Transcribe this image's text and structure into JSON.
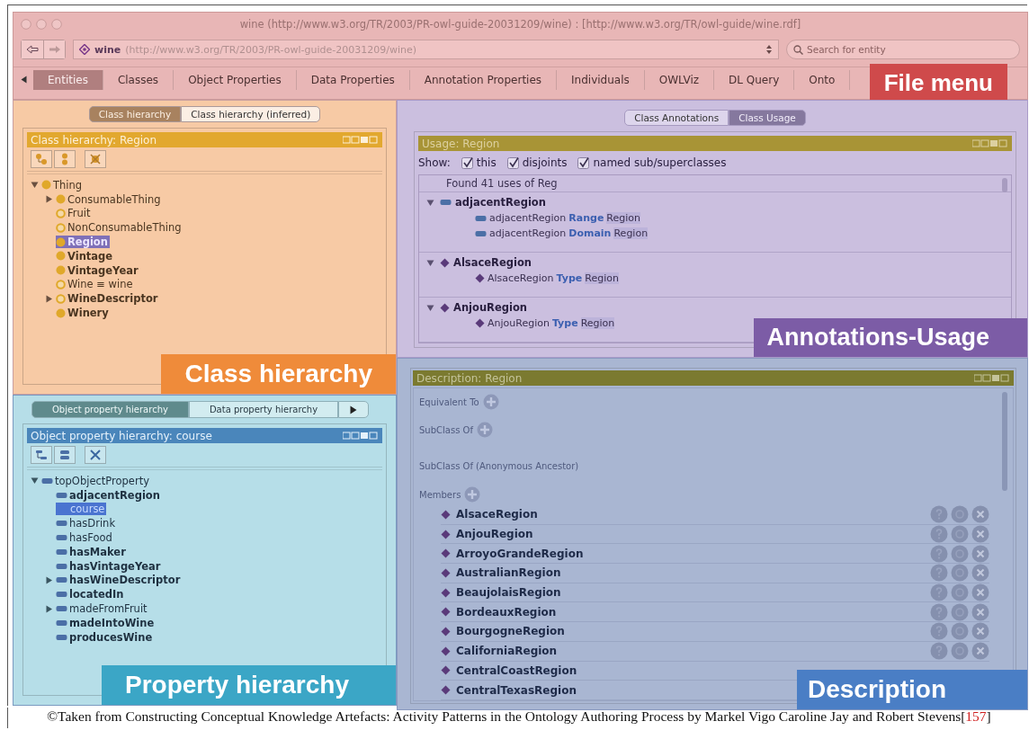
{
  "window": {
    "title": "wine (http://www.w3.org/TR/2003/PR-owl-guide-20031209/wine)  : [http://www.w3.org/TR/owl-guide/wine.rdf]"
  },
  "address_bar": {
    "ontology": "wine",
    "uri": "(http://www.w3.org/TR/2003/PR-owl-guide-20031209/wine)",
    "search": {
      "placeholder": "Search for entity"
    }
  },
  "tabs": [
    {
      "label": "Entities",
      "selected": true
    },
    {
      "label": "Classes",
      "selected": false
    },
    {
      "label": "Object Properties",
      "selected": false
    },
    {
      "label": "Data Properties",
      "selected": false
    },
    {
      "label": "Annotation Properties",
      "selected": false
    },
    {
      "label": "Individuals",
      "selected": false
    },
    {
      "label": "OWLViz",
      "selected": false
    },
    {
      "label": "DL Query",
      "selected": false
    },
    {
      "label": "Onto",
      "selected": false
    }
  ],
  "callouts": [
    {
      "label": "File menu",
      "color": "#cf4a4b"
    },
    {
      "label": "Class hierarchy",
      "color": "#ef8b3a"
    },
    {
      "label": "Annotations-Usage",
      "color": "#7c5ca6"
    },
    {
      "label": "Property hierarchy",
      "color": "#3ba6c6"
    },
    {
      "label": "Description",
      "color": "#4a7ec5"
    }
  ],
  "class_panel": {
    "tabs": [
      {
        "label": "Class hierarchy",
        "selected": true
      },
      {
        "label": "Class hierarchy (inferred)",
        "selected": false
      }
    ],
    "title": "Class hierarchy: Region",
    "tree": [
      {
        "label": "Thing",
        "kind": "primitive",
        "bold": false,
        "selected": false,
        "expanded": true,
        "children": [
          {
            "label": "ConsumableThing",
            "kind": "primitive",
            "bold": false,
            "selected": false,
            "expanded": false
          },
          {
            "label": "Fruit",
            "kind": "defined",
            "bold": false,
            "selected": false
          },
          {
            "label": "NonConsumableThing",
            "kind": "defined",
            "bold": false,
            "selected": false
          },
          {
            "label": "Region",
            "kind": "primitive",
            "bold": true,
            "selected": true
          },
          {
            "label": "Vintage",
            "kind": "primitive",
            "bold": true,
            "selected": false
          },
          {
            "label": "VintageYear",
            "kind": "primitive",
            "bold": true,
            "selected": false
          },
          {
            "label": "Wine ≡ wine",
            "kind": "defined",
            "bold": false,
            "selected": false
          },
          {
            "label": "WineDescriptor",
            "kind": "defined",
            "bold": true,
            "selected": false,
            "expanded": false
          },
          {
            "label": "Winery",
            "kind": "primitive",
            "bold": true,
            "selected": false
          }
        ]
      }
    ]
  },
  "usage_panel": {
    "tabs": [
      {
        "label": "Class Annotations",
        "selected": false
      },
      {
        "label": "Class Usage",
        "selected": true
      }
    ],
    "title": "Usage: Region",
    "show_label": "Show:",
    "filters": [
      {
        "label": "this",
        "checked": true
      },
      {
        "label": "disjoints",
        "checked": true
      },
      {
        "label": "named sub/superclasses",
        "checked": true
      }
    ],
    "found": "Found 41 uses of Reg",
    "groups": [
      {
        "label": "adjacentRegion",
        "kind": "property",
        "expanded": true,
        "axioms": [
          {
            "subject": "adjacentRegion",
            "keyword": "Range",
            "object": "Region"
          },
          {
            "subject": "adjacentRegion",
            "keyword": "Domain",
            "object": "Region"
          }
        ]
      },
      {
        "label": "AlsaceRegion",
        "kind": "individual",
        "expanded": true,
        "axioms": [
          {
            "subject": "AlsaceRegion",
            "keyword": "Type",
            "object": "Region"
          }
        ]
      },
      {
        "label": "AnjouRegion",
        "kind": "individual",
        "expanded": true,
        "axioms": [
          {
            "subject": "AnjouRegion",
            "keyword": "Type",
            "object": "Region"
          }
        ]
      }
    ]
  },
  "property_panel": {
    "tabs": [
      {
        "label": "Object property hierarchy",
        "selected": true
      },
      {
        "label": "Data property hierarchy",
        "selected": false
      }
    ],
    "title": "Object property hierarchy: course",
    "tree": [
      {
        "label": "topObjectProperty",
        "kind": "property",
        "bold": false,
        "selected": false,
        "expanded": true,
        "children": [
          {
            "label": "adjacentRegion",
            "kind": "property",
            "bold": true,
            "selected": false
          },
          {
            "label": "course",
            "kind": "property",
            "bold": false,
            "selected": true
          },
          {
            "label": "hasDrink",
            "kind": "property",
            "bold": false,
            "selected": false
          },
          {
            "label": "hasFood",
            "kind": "property",
            "bold": false,
            "selected": false
          },
          {
            "label": "hasMaker",
            "kind": "property",
            "bold": true,
            "selected": false
          },
          {
            "label": "hasVintageYear",
            "kind": "property",
            "bold": true,
            "selected": false
          },
          {
            "label": "hasWineDescriptor",
            "kind": "property",
            "bold": true,
            "selected": false,
            "expanded": false
          },
          {
            "label": "locatedIn",
            "kind": "property",
            "bold": true,
            "selected": false
          },
          {
            "label": "madeFromFruit",
            "kind": "property",
            "bold": false,
            "selected": false,
            "expanded": false
          },
          {
            "label": "madeIntoWine",
            "kind": "property",
            "bold": true,
            "selected": false
          },
          {
            "label": "producesWine",
            "kind": "property",
            "bold": true,
            "selected": false
          }
        ]
      }
    ]
  },
  "description_panel": {
    "title": "Description: Region",
    "sections": [
      {
        "label": "Equivalent To",
        "addable": true
      },
      {
        "label": "SubClass Of",
        "addable": true
      },
      {
        "label": "SubClass Of (Anonymous Ancestor)",
        "addable": false
      },
      {
        "label": "Members",
        "addable": true
      }
    ],
    "members": [
      {
        "label": "AlsaceRegion",
        "actions": true
      },
      {
        "label": "AnjouRegion",
        "actions": true
      },
      {
        "label": "ArroyoGrandeRegion",
        "actions": true
      },
      {
        "label": "AustralianRegion",
        "actions": true
      },
      {
        "label": "BeaujolaisRegion",
        "actions": true
      },
      {
        "label": "BordeauxRegion",
        "actions": true
      },
      {
        "label": "BourgogneRegion",
        "actions": true
      },
      {
        "label": "CaliforniaRegion",
        "actions": true
      },
      {
        "label": "CentralCoastRegion",
        "actions": false
      },
      {
        "label": "CentralTexasRegion"
      }
    ]
  },
  "caption": {
    "before": "©Taken from Constructing Conceptual Knowledge Artefacts: Activity Patterns in the Ontology Authoring Process by Markel Vigo Caroline Jay and Robert Stevens[",
    "ref": "157",
    "after": "]"
  }
}
